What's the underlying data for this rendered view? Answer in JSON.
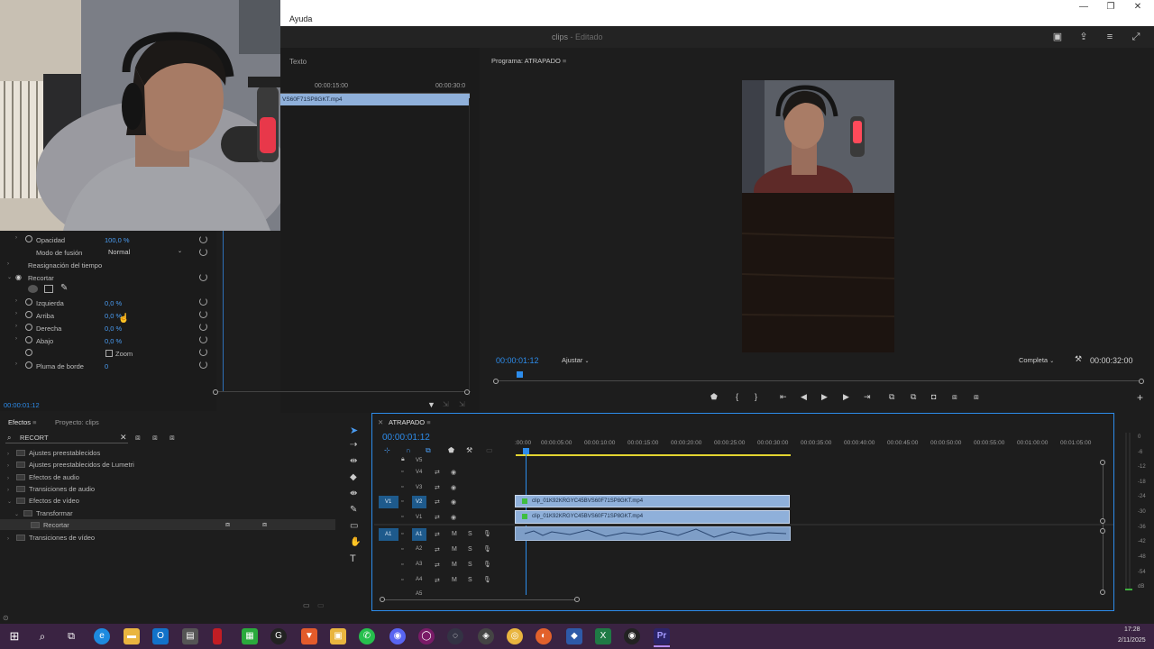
{
  "window": {
    "menu": "Ayuda",
    "controls": [
      "—",
      "❐",
      "✕"
    ]
  },
  "app_header": {
    "title": "clips",
    "subtitle": "- Editado"
  },
  "source_panel": {
    "tab": "Texto",
    "ruler": [
      "00:00:15:00",
      "00:00:30:0"
    ],
    "clip_label": "VS60F71SP8GKT.mp4"
  },
  "effect_controls": {
    "opacity_label": "Opacidad",
    "opacity_value": "100,0 %",
    "blend_label": "Modo de fusión",
    "blend_value": "Normal",
    "time_remap": "Reasignación del tiempo",
    "crop_label": "Recortar",
    "left_label": "Izquierda",
    "left_value": "0,0 %",
    "top_label": "Arriba",
    "top_value": "0,0 %",
    "right_label": "Derecha",
    "right_value": "0,0 %",
    "bottom_label": "Abajo",
    "bottom_value": "0,0 %",
    "zoom_label": "Zoom",
    "feather_label": "Pluma de borde",
    "feather_value": "0",
    "timecode": "00:00:01:12"
  },
  "program_monitor": {
    "title": "Programa: ATRAPADO",
    "timecode": "00:00:01:12",
    "fit": "Ajustar",
    "quality": "Completa",
    "duration": "00:00:32:00"
  },
  "effects_panel": {
    "tabs": [
      "Efectos",
      "Proyecto: clips"
    ],
    "search_value": "RECORT",
    "items": [
      "Ajustes preestablecidos",
      "Ajustes preestablecidos de Lumetri",
      "Efectos de audio",
      "Transiciones de audio",
      "Efectos de vídeo",
      "Transformar",
      "Recortar",
      "Transiciones de vídeo"
    ]
  },
  "timeline": {
    "sequence": "ATRAPADO",
    "timecode": "00:00:01:12",
    "ruler": [
      ":00:00",
      "00:00:05:00",
      "00:00:10:00",
      "00:00:15:00",
      "00:00:20:00",
      "00:00:25:00",
      "00:00:30:00",
      "00:00:35:00",
      "00:00:40:00",
      "00:00:45:00",
      "00:00:50:00",
      "00:00:55:00",
      "00:01:00:00",
      "00:01:05:00"
    ],
    "video_tracks": [
      "V5",
      "V4",
      "V3",
      "V2",
      "V1"
    ],
    "audio_tracks": [
      "A1",
      "A2",
      "A3",
      "A4",
      "A5"
    ],
    "left_targets": [
      "V1",
      "A1"
    ],
    "clip_v2": "clip_01K92KRGYC45BVS60F71SP8GKT.mp4",
    "clip_v1": "clip_01K92KRGYC45BVS60F71SP8GKT.mp4",
    "track_buttons": {
      "mute": "M",
      "solo": "S"
    }
  },
  "audio_meter": {
    "labels": [
      "0",
      "-6",
      "-12",
      "-18",
      "-24",
      "-30",
      "-36",
      "-42",
      "-48",
      "-54",
      "dB"
    ]
  },
  "taskbar": {
    "time": "17:28",
    "date": "2/11/2025"
  },
  "colors": {
    "accent": "#2d8ceb",
    "clip": "#8fb0da",
    "panel": "#1d1d1d"
  }
}
